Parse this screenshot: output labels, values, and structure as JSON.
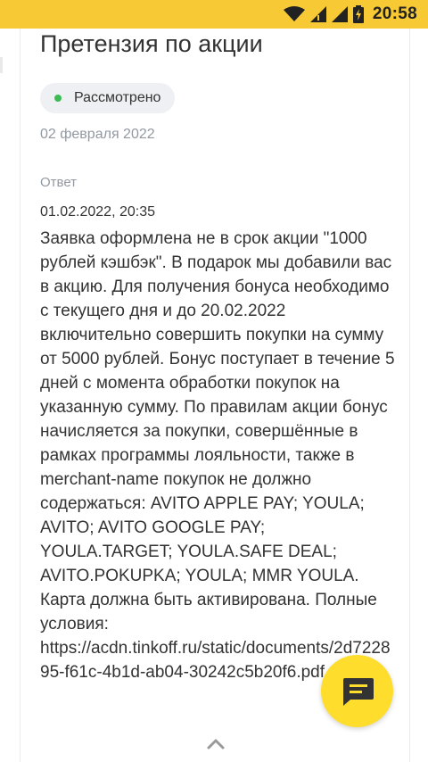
{
  "status_bar": {
    "time": "20:58",
    "icons": [
      "wifi-icon",
      "signal-icon",
      "signal-icon",
      "battery-charging-icon"
    ]
  },
  "claim": {
    "title": "Претензия по акции",
    "status_label": "Рассмотрено",
    "status_color": "#3dbb55",
    "date": "02 февраля 2022"
  },
  "answer": {
    "section_label": "Ответ",
    "datetime": "01.02.2022, 20:35",
    "text": "Заявка оформлена не в срок акции \"1000 рублей кэшбэк\". В подарок мы добавили вас в акцию. Для получения бонуса необходимо с текущего дня и до 20.02.2022 включительно совершить покупки на сумму от 5000 рублей. Бонус поступает в течение 5 дней с момента обработки покупок на указанную сумму. По правилам акции бонус начисляется за покупки, совершённые в рамках программы лояльности, также в merchant-name покупок не должно содержаться: AVITO APPLE PAY; YOULA; AVITO; AVITO GOOGLE PAY; YOULA.TARGET; YOULA.SAFE DEAL; AVITO.POKUPKA; YOULA; MMR YOULA. Карта должна быть активирована. Полные условия: https://acdn.tinkoff.ru/static/documents/2d722895-f61c-4b1d-ab04-30242c5b20f6.pdf"
  },
  "controls": {
    "scroll_up_icon": "chevron-up-icon",
    "chat_icon": "chat-icon"
  },
  "colors": {
    "accent": "#ffdd2d",
    "status_bar": "#f7c934"
  }
}
